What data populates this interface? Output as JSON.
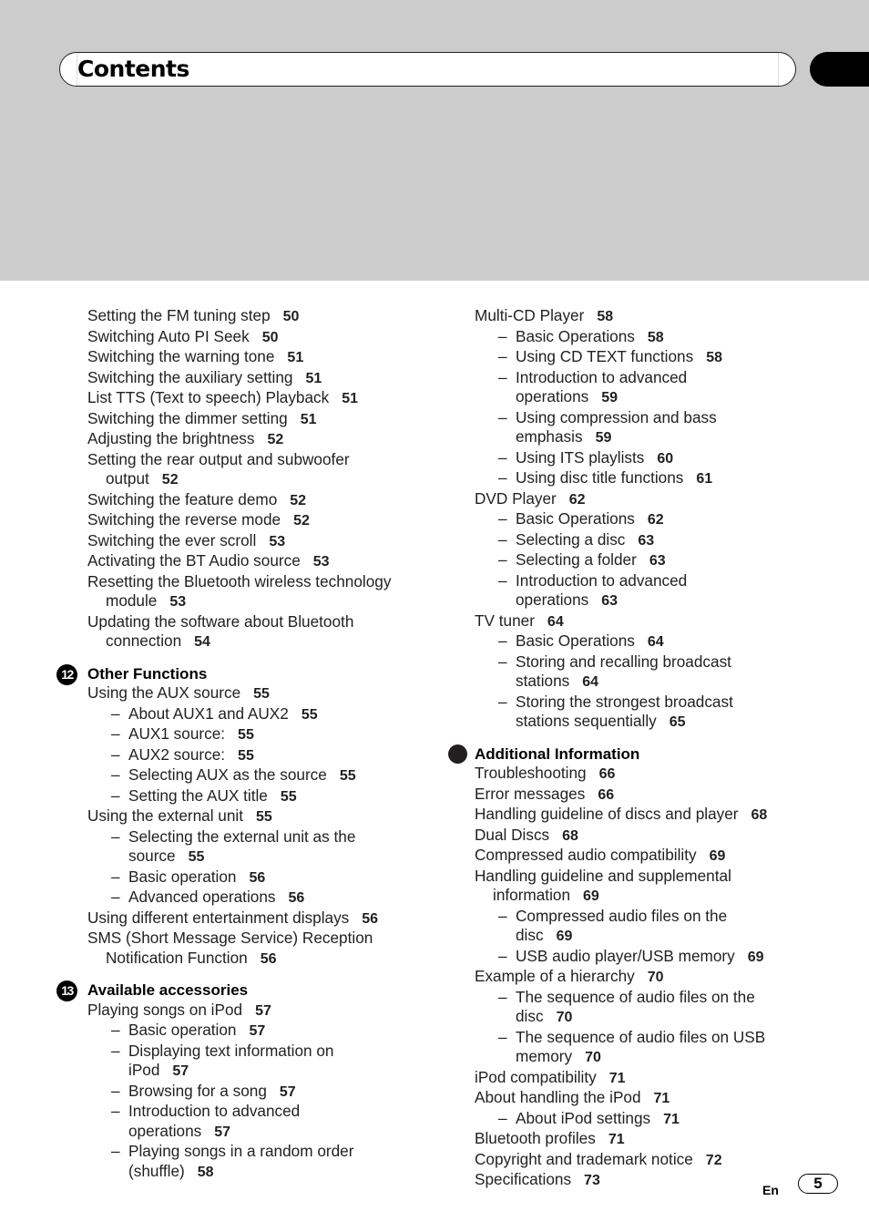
{
  "header": {
    "title": "Contents"
  },
  "left_column": [
    {
      "type": "entry",
      "level": 1,
      "text": "Setting the FM tuning step",
      "page": "50"
    },
    {
      "type": "entry",
      "level": 1,
      "text": "Switching Auto PI Seek",
      "page": "50"
    },
    {
      "type": "entry",
      "level": 1,
      "text": "Switching the warning tone",
      "page": "51"
    },
    {
      "type": "entry",
      "level": 1,
      "text": "Switching the auxiliary setting",
      "page": "51"
    },
    {
      "type": "entry",
      "level": 1,
      "text": "List TTS (Text to speech) Playback",
      "page": "51"
    },
    {
      "type": "entry",
      "level": 1,
      "text": "Switching the dimmer setting",
      "page": "51"
    },
    {
      "type": "entry",
      "level": 1,
      "text": "Adjusting the brightness",
      "page": "52"
    },
    {
      "type": "entry",
      "level": 1,
      "text": "Setting the rear output and subwoofer",
      "cont": "output",
      "page": "52"
    },
    {
      "type": "entry",
      "level": 1,
      "text": "Switching the feature demo",
      "page": "52"
    },
    {
      "type": "entry",
      "level": 1,
      "text": "Switching the reverse mode",
      "page": "52"
    },
    {
      "type": "entry",
      "level": 1,
      "text": "Switching the ever scroll",
      "page": "53"
    },
    {
      "type": "entry",
      "level": 1,
      "text": "Activating the BT Audio source",
      "page": "53"
    },
    {
      "type": "entry",
      "level": 1,
      "text": "Resetting the Bluetooth wireless technology",
      "cont": "module",
      "page": "53"
    },
    {
      "type": "entry",
      "level": 1,
      "text": "Updating the software about Bluetooth",
      "cont": "connection",
      "page": "54"
    },
    {
      "type": "section",
      "badge": "12",
      "text": "Other Functions"
    },
    {
      "type": "entry",
      "level": 1,
      "text": "Using the AUX source",
      "page": "55"
    },
    {
      "type": "entry",
      "level": 2,
      "text": "About AUX1 and AUX2",
      "page": "55"
    },
    {
      "type": "entry",
      "level": 2,
      "text": "AUX1 source:",
      "page": "55"
    },
    {
      "type": "entry",
      "level": 2,
      "text": "AUX2 source:",
      "page": "55"
    },
    {
      "type": "entry",
      "level": 2,
      "text": "Selecting AUX as the source",
      "page": "55"
    },
    {
      "type": "entry",
      "level": 2,
      "text": "Setting the AUX title",
      "page": "55"
    },
    {
      "type": "entry",
      "level": 1,
      "text": "Using the external unit",
      "page": "55"
    },
    {
      "type": "entry",
      "level": 2,
      "text": "Selecting the external unit as the",
      "cont": "source",
      "page": "55"
    },
    {
      "type": "entry",
      "level": 2,
      "text": "Basic operation",
      "page": "56"
    },
    {
      "type": "entry",
      "level": 2,
      "text": "Advanced operations",
      "page": "56"
    },
    {
      "type": "entry",
      "level": 1,
      "text": "Using different entertainment displays",
      "page": "56"
    },
    {
      "type": "entry",
      "level": 1,
      "text": "SMS (Short Message Service) Reception",
      "cont": "Notification Function",
      "page": "56"
    },
    {
      "type": "section",
      "badge": "13",
      "text": "Available accessories"
    },
    {
      "type": "entry",
      "level": 1,
      "text": "Playing songs on iPod",
      "page": "57"
    },
    {
      "type": "entry",
      "level": 2,
      "text": "Basic operation",
      "page": "57"
    },
    {
      "type": "entry",
      "level": 2,
      "text": "Displaying text information on",
      "cont": "iPod",
      "page": "57"
    },
    {
      "type": "entry",
      "level": 2,
      "text": "Browsing for a song",
      "page": "57"
    },
    {
      "type": "entry",
      "level": 2,
      "text": "Introduction to advanced",
      "cont": "operations",
      "page": "57"
    },
    {
      "type": "entry",
      "level": 2,
      "text": "Playing songs in a random order",
      "cont": "(shuffle)",
      "page": "58"
    }
  ],
  "right_column": [
    {
      "type": "entry",
      "level": 1,
      "text": "Multi-CD Player",
      "page": "58"
    },
    {
      "type": "entry",
      "level": 2,
      "text": "Basic Operations",
      "page": "58"
    },
    {
      "type": "entry",
      "level": 2,
      "text": "Using CD TEXT functions",
      "page": "58"
    },
    {
      "type": "entry",
      "level": 2,
      "text": "Introduction to advanced",
      "cont": "operations",
      "page": "59"
    },
    {
      "type": "entry",
      "level": 2,
      "text": "Using compression and bass",
      "cont": "emphasis",
      "page": "59"
    },
    {
      "type": "entry",
      "level": 2,
      "text": "Using ITS playlists",
      "page": "60"
    },
    {
      "type": "entry",
      "level": 2,
      "text": "Using disc title functions",
      "page": "61"
    },
    {
      "type": "entry",
      "level": 1,
      "text": "DVD Player",
      "page": "62"
    },
    {
      "type": "entry",
      "level": 2,
      "text": "Basic Operations",
      "page": "62"
    },
    {
      "type": "entry",
      "level": 2,
      "text": "Selecting a disc",
      "page": "63"
    },
    {
      "type": "entry",
      "level": 2,
      "text": "Selecting a folder",
      "page": "63"
    },
    {
      "type": "entry",
      "level": 2,
      "text": "Introduction to advanced",
      "cont": "operations",
      "page": "63"
    },
    {
      "type": "entry",
      "level": 1,
      "text": "TV tuner",
      "page": "64"
    },
    {
      "type": "entry",
      "level": 2,
      "text": "Basic Operations",
      "page": "64"
    },
    {
      "type": "entry",
      "level": 2,
      "text": "Storing and recalling broadcast",
      "cont": "stations",
      "page": "64"
    },
    {
      "type": "entry",
      "level": 2,
      "text": "Storing the strongest broadcast",
      "cont": "stations sequentially",
      "page": "65"
    },
    {
      "type": "section",
      "badge": "",
      "text": "Additional Information"
    },
    {
      "type": "entry",
      "level": 1,
      "text": "Troubleshooting",
      "page": "66"
    },
    {
      "type": "entry",
      "level": 1,
      "text": "Error messages",
      "page": "66"
    },
    {
      "type": "entry",
      "level": 1,
      "text": "Handling guideline of discs and player",
      "page": "68"
    },
    {
      "type": "entry",
      "level": 1,
      "text": "Dual Discs",
      "page": "68"
    },
    {
      "type": "entry",
      "level": 1,
      "text": "Compressed audio compatibility",
      "page": "69"
    },
    {
      "type": "entry",
      "level": 1,
      "text": "Handling guideline and supplemental",
      "cont": "information",
      "page": "69"
    },
    {
      "type": "entry",
      "level": 2,
      "text": "Compressed audio files on the",
      "cont": "disc",
      "page": "69"
    },
    {
      "type": "entry",
      "level": 2,
      "text": "USB audio player/USB memory",
      "page": "69"
    },
    {
      "type": "entry",
      "level": 1,
      "text": "Example of a hierarchy",
      "page": "70"
    },
    {
      "type": "entry",
      "level": 2,
      "text": "The sequence of audio files on the",
      "cont": "disc",
      "page": "70"
    },
    {
      "type": "entry",
      "level": 2,
      "text": "The sequence of audio files on USB",
      "cont": "memory",
      "page": "70"
    },
    {
      "type": "entry",
      "level": 1,
      "text": "iPod compatibility",
      "page": "71"
    },
    {
      "type": "entry",
      "level": 1,
      "text": "About handling the iPod",
      "page": "71"
    },
    {
      "type": "entry",
      "level": 2,
      "text": "About iPod settings",
      "page": "71"
    },
    {
      "type": "entry",
      "level": 1,
      "text": "Bluetooth profiles",
      "page": "71"
    },
    {
      "type": "entry",
      "level": 1,
      "text": "Copyright and trademark notice",
      "page": "72"
    },
    {
      "type": "entry",
      "level": 1,
      "text": "Specifications",
      "page": "73"
    }
  ],
  "dash_glyph": "–",
  "footer": {
    "language": "En",
    "page_number": "5"
  },
  "colors": {
    "band": "#cccccc",
    "text": "#231f20",
    "accent": "#000000"
  }
}
